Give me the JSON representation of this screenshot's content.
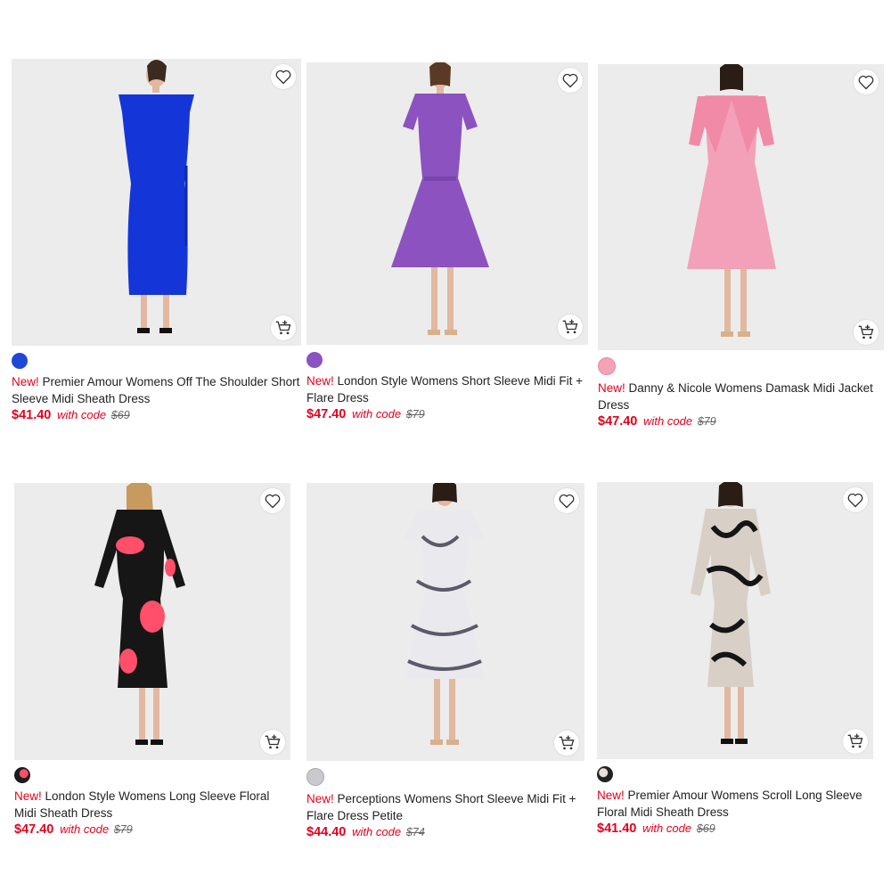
{
  "products": [
    {
      "badge": "New!",
      "title": "Premier Amour Womens Off The Shoulder Short Sleeve Midi Sheath Dress",
      "price": "$41.40",
      "code_text": "with code",
      "original_price": "$69",
      "swatch_color": "#1f47d6",
      "dress_color": "#1436d8"
    },
    {
      "badge": "New!",
      "title": "London Style Womens Short Sleeve Midi Fit + Flare Dress",
      "price": "$47.40",
      "code_text": "with code",
      "original_price": "$79",
      "swatch_color": "#8a52c3",
      "dress_color": "#8c52c0"
    },
    {
      "badge": "New!",
      "title": "Danny & Nicole Womens Damask Midi Jacket Dress",
      "price": "$47.40",
      "code_text": "with code",
      "original_price": "$79",
      "swatch_color": "#f3a3b5",
      "dress_color": "#f2a1b8"
    },
    {
      "badge": "New!",
      "title": "London Style Womens Long Sleeve Floral Midi Sheath Dress",
      "price": "$47.40",
      "code_text": "with code",
      "original_price": "$79",
      "swatch_color": "#1b1b1b",
      "dress_color": "#161616"
    },
    {
      "badge": "New!",
      "title": "Perceptions Womens Short Sleeve Midi Fit + Flare Dress Petite",
      "price": "$44.40",
      "code_text": "with code",
      "original_price": "$74",
      "swatch_color": "#c9c9cf",
      "dress_color": "#e9e9ee"
    },
    {
      "badge": "New!",
      "title": "Premier Amour Womens Scroll Long Sleeve Floral Midi Sheath Dress",
      "price": "$41.40",
      "code_text": "with code",
      "original_price": "$69",
      "swatch_color": "#222222",
      "dress_color": "#d8cfc7"
    }
  ],
  "colors": {
    "accent": "#e4001c",
    "image_bg": "#ececec"
  },
  "icons": {
    "favorite": "heart-icon",
    "add_to_cart": "cart-plus-icon"
  }
}
